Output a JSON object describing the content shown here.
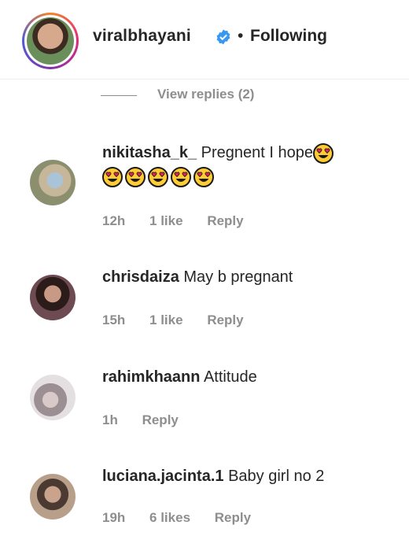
{
  "post_header": {
    "username": "viralbhayani",
    "separator": "•",
    "follow_status": "Following",
    "verified_badge_color": "#3897f0"
  },
  "thread": {
    "view_replies_label": "View replies (2)"
  },
  "comments": [
    {
      "username": "nikitasha_k_",
      "text": "Pregnent I hope",
      "trailing_emoji_count": 6,
      "emoji_icon": "heart-eyes-emoji",
      "time": "12h",
      "likes": "1 like",
      "reply_label": "Reply"
    },
    {
      "username": "chrisdaiza",
      "text": "May b pregnant",
      "time": "15h",
      "likes": "1 like",
      "reply_label": "Reply"
    },
    {
      "username": "rahimkhaann",
      "text": "Attitude",
      "time": "1h",
      "likes": "",
      "reply_label": "Reply"
    },
    {
      "username": "luciana.jacinta.1",
      "text": "Baby girl no 2",
      "time": "19h",
      "likes": "6 likes",
      "reply_label": "Reply"
    }
  ],
  "colors": {
    "primary_text": "#262626",
    "secondary_text": "#8e8e8e",
    "background": "#ffffff"
  }
}
